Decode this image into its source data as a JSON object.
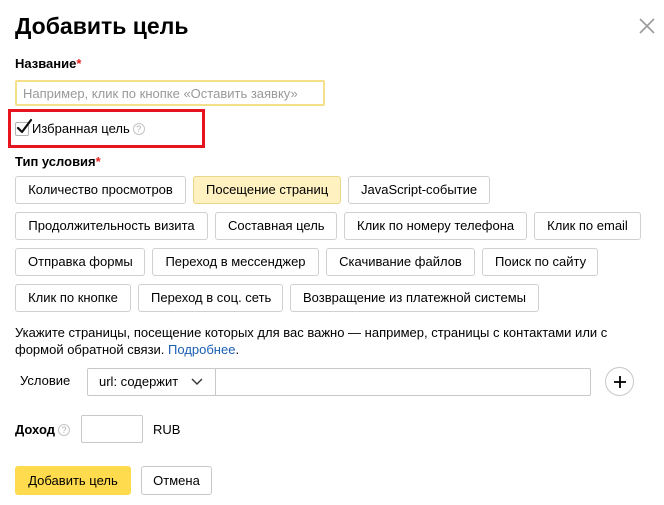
{
  "dialog": {
    "title": "Добавить цель",
    "close_icon": "close-icon"
  },
  "name_field": {
    "label": "Название",
    "required_mark": "*",
    "placeholder": "Например, клик по кнопке «Оставить заявку»",
    "value": ""
  },
  "favorite": {
    "label": "Избранная цель",
    "checked": true,
    "help_icon": "help-icon",
    "help_glyph": "?"
  },
  "condition_type": {
    "label": "Тип условия",
    "required_mark": "*",
    "options": [
      {
        "label": "Количество просмотров",
        "selected": false
      },
      {
        "label": "Посещение страниц",
        "selected": true
      },
      {
        "label": "JavaScript-событие",
        "selected": false
      },
      {
        "label": "Продолжительность визита",
        "selected": false
      },
      {
        "label": "Составная цель",
        "selected": false
      },
      {
        "label": "Клик по номеру телефона",
        "selected": false
      },
      {
        "label": "Клик по email",
        "selected": false
      },
      {
        "label": "Отправка формы",
        "selected": false
      },
      {
        "label": "Переход в мессенджер",
        "selected": false
      },
      {
        "label": "Скачивание файлов",
        "selected": false
      },
      {
        "label": "Поиск по сайту",
        "selected": false
      },
      {
        "label": "Клик по кнопке",
        "selected": false
      },
      {
        "label": "Переход в соц. сеть",
        "selected": false
      },
      {
        "label": "Возвращение из платежной системы",
        "selected": false
      }
    ]
  },
  "hint": {
    "text": "Укажите страницы, посещение которых для вас важно — например, страницы с контактами или с формой обратной связи. ",
    "link": "Подробнее",
    "end": "."
  },
  "condition": {
    "label": "Условие",
    "select_value": "url: содержит",
    "input_value": "",
    "add_icon": "plus-icon"
  },
  "income": {
    "label": "Доход",
    "help_glyph": "?",
    "value": "",
    "currency": "RUB"
  },
  "actions": {
    "submit": "Добавить цель",
    "cancel": "Отмена"
  },
  "colors": {
    "accent": "#ffdb4d",
    "selected_chip": "#fff1c0",
    "highlight_frame": "#e6141e",
    "required": "#e52020",
    "link": "#1a5fb4"
  }
}
